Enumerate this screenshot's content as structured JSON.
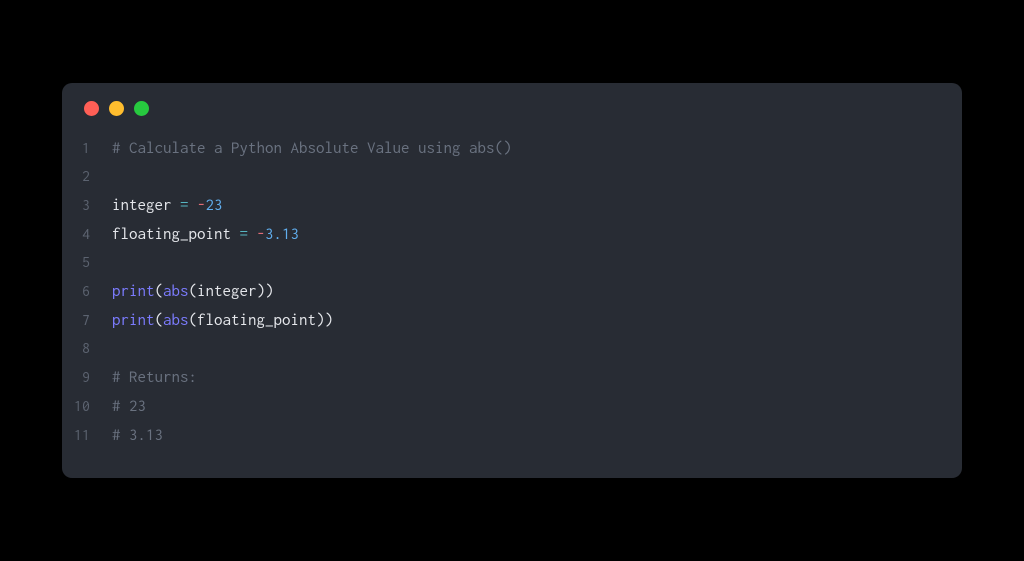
{
  "code": {
    "lines": [
      {
        "num": "1",
        "tokens": [
          {
            "cls": "tok-comment",
            "text": "# Calculate a Python Absolute Value using abs()"
          }
        ]
      },
      {
        "num": "2",
        "tokens": []
      },
      {
        "num": "3",
        "tokens": [
          {
            "cls": "tok-variable",
            "text": "integer"
          },
          {
            "cls": "tok-variable",
            "text": " "
          },
          {
            "cls": "tok-operator",
            "text": "="
          },
          {
            "cls": "tok-variable",
            "text": " "
          },
          {
            "cls": "tok-negative",
            "text": "-"
          },
          {
            "cls": "tok-number",
            "text": "23"
          }
        ]
      },
      {
        "num": "4",
        "tokens": [
          {
            "cls": "tok-variable",
            "text": "floating_point"
          },
          {
            "cls": "tok-variable",
            "text": " "
          },
          {
            "cls": "tok-operator",
            "text": "="
          },
          {
            "cls": "tok-variable",
            "text": " "
          },
          {
            "cls": "tok-negative",
            "text": "-"
          },
          {
            "cls": "tok-number",
            "text": "3.13"
          }
        ]
      },
      {
        "num": "5",
        "tokens": []
      },
      {
        "num": "6",
        "tokens": [
          {
            "cls": "tok-builtin",
            "text": "print"
          },
          {
            "cls": "tok-punct",
            "text": "("
          },
          {
            "cls": "tok-builtin",
            "text": "abs"
          },
          {
            "cls": "tok-punct",
            "text": "("
          },
          {
            "cls": "tok-identifier",
            "text": "integer"
          },
          {
            "cls": "tok-punct",
            "text": "))"
          }
        ]
      },
      {
        "num": "7",
        "tokens": [
          {
            "cls": "tok-builtin",
            "text": "print"
          },
          {
            "cls": "tok-punct",
            "text": "("
          },
          {
            "cls": "tok-builtin",
            "text": "abs"
          },
          {
            "cls": "tok-punct",
            "text": "("
          },
          {
            "cls": "tok-identifier",
            "text": "floating_point"
          },
          {
            "cls": "tok-punct",
            "text": "))"
          }
        ]
      },
      {
        "num": "8",
        "tokens": []
      },
      {
        "num": "9",
        "tokens": [
          {
            "cls": "tok-comment",
            "text": "# Returns:"
          }
        ]
      },
      {
        "num": "10",
        "tokens": [
          {
            "cls": "tok-comment",
            "text": "# 23"
          }
        ]
      },
      {
        "num": "11",
        "tokens": [
          {
            "cls": "tok-comment",
            "text": "# 3.13"
          }
        ]
      }
    ]
  }
}
